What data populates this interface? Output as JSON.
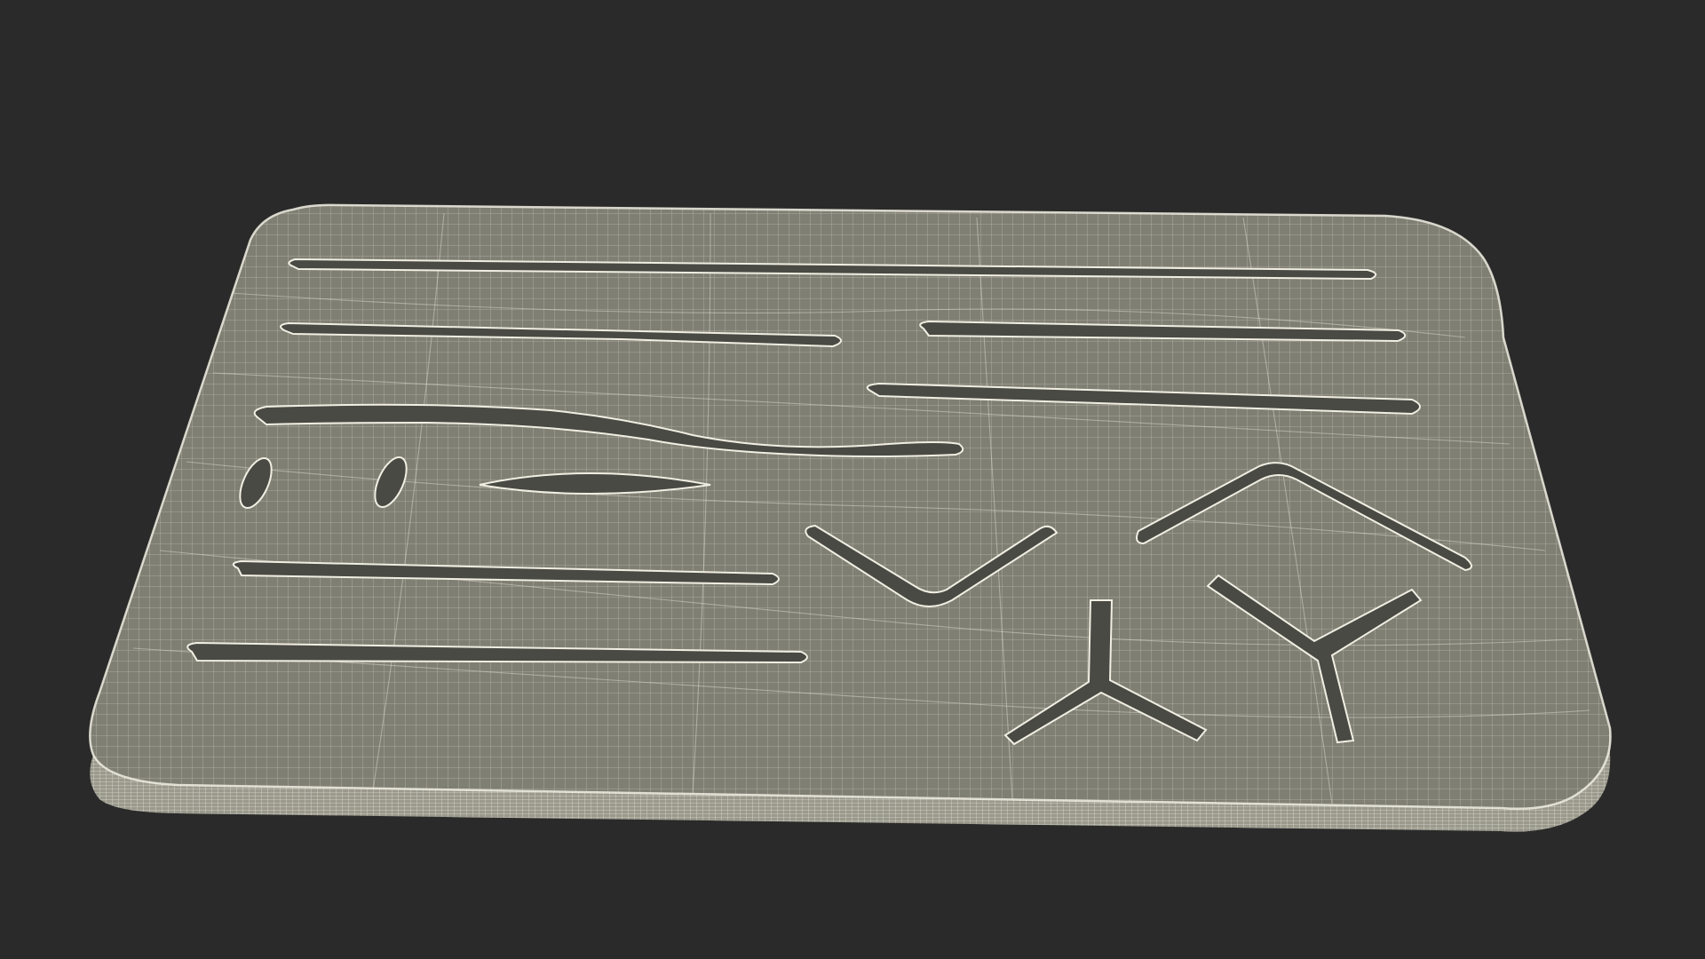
{
  "scene": {
    "subject": "wireframe-board-model",
    "colors": {
      "background": "#2a2a2a",
      "surface": "#807f74",
      "surface_dark": "#6f6e64",
      "side": "#9a998c",
      "wire": "#e6e4d8",
      "cut_shadow": "#4a4a44",
      "cut_edge": "#f1efe3"
    }
  }
}
